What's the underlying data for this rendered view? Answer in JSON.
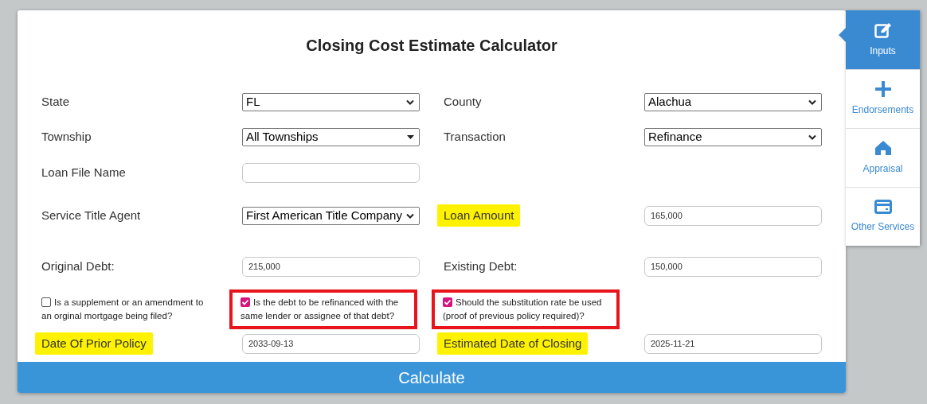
{
  "title": "Closing Cost Estimate Calculator",
  "rows": [
    [
      {
        "label": "State",
        "highlighted": false,
        "control": {
          "kind": "select",
          "value": "FL"
        }
      },
      {
        "label": "County",
        "highlighted": false,
        "control": {
          "kind": "select",
          "value": "Alachua"
        }
      }
    ],
    [
      {
        "label": "Township",
        "highlighted": false,
        "control": {
          "kind": "dropdown",
          "value": "All Townships"
        }
      },
      {
        "label": "Transaction",
        "highlighted": false,
        "control": {
          "kind": "select",
          "value": "Refinance"
        }
      }
    ],
    [
      {
        "label": "Loan File Name",
        "highlighted": false,
        "control": {
          "kind": "input"
        }
      }
    ],
    [
      {
        "label": "Service Title Agent",
        "highlighted": false,
        "control": {
          "kind": "select",
          "value": "First American Title Company"
        }
      },
      {
        "label": "Loan Amount",
        "highlighted": true,
        "control": {
          "kind": "input",
          "value": "165,000"
        }
      }
    ],
    [
      {
        "label": "Original Debt:",
        "highlighted": false,
        "control": {
          "kind": "input",
          "value": "215,000"
        }
      },
      {
        "label": "Existing Debt:",
        "highlighted": false,
        "control": {
          "kind": "input",
          "value": "150,000"
        }
      }
    ]
  ],
  "checkboxes": [
    {
      "label": "Is a supplement or an amendment to an orginal mortgage being filed?",
      "checked": false,
      "outlined": false
    },
    {
      "label": "Is the debt to be refinanced with the same lender or assignee of that debt?",
      "checked": true,
      "outlined": true
    },
    {
      "label": "Should the substitution rate be used (proof of previous policy required)?",
      "checked": true,
      "outlined": true
    }
  ],
  "date_row": [
    {
      "label": "Date Of Prior Policy",
      "highlighted": true,
      "control": {
        "kind": "input",
        "value": "2033-09-13"
      }
    },
    {
      "label": "Estimated Date of Closing",
      "highlighted": true,
      "control": {
        "kind": "input",
        "value": "2025-11-21"
      }
    }
  ],
  "calculate_button": "Calculate",
  "side_tabs": [
    {
      "label": "Inputs",
      "selected": true
    },
    {
      "label": "Endorsements",
      "selected": false
    },
    {
      "label": "Appraisal",
      "selected": false
    },
    {
      "label": "Other Services",
      "selected": false
    }
  ]
}
